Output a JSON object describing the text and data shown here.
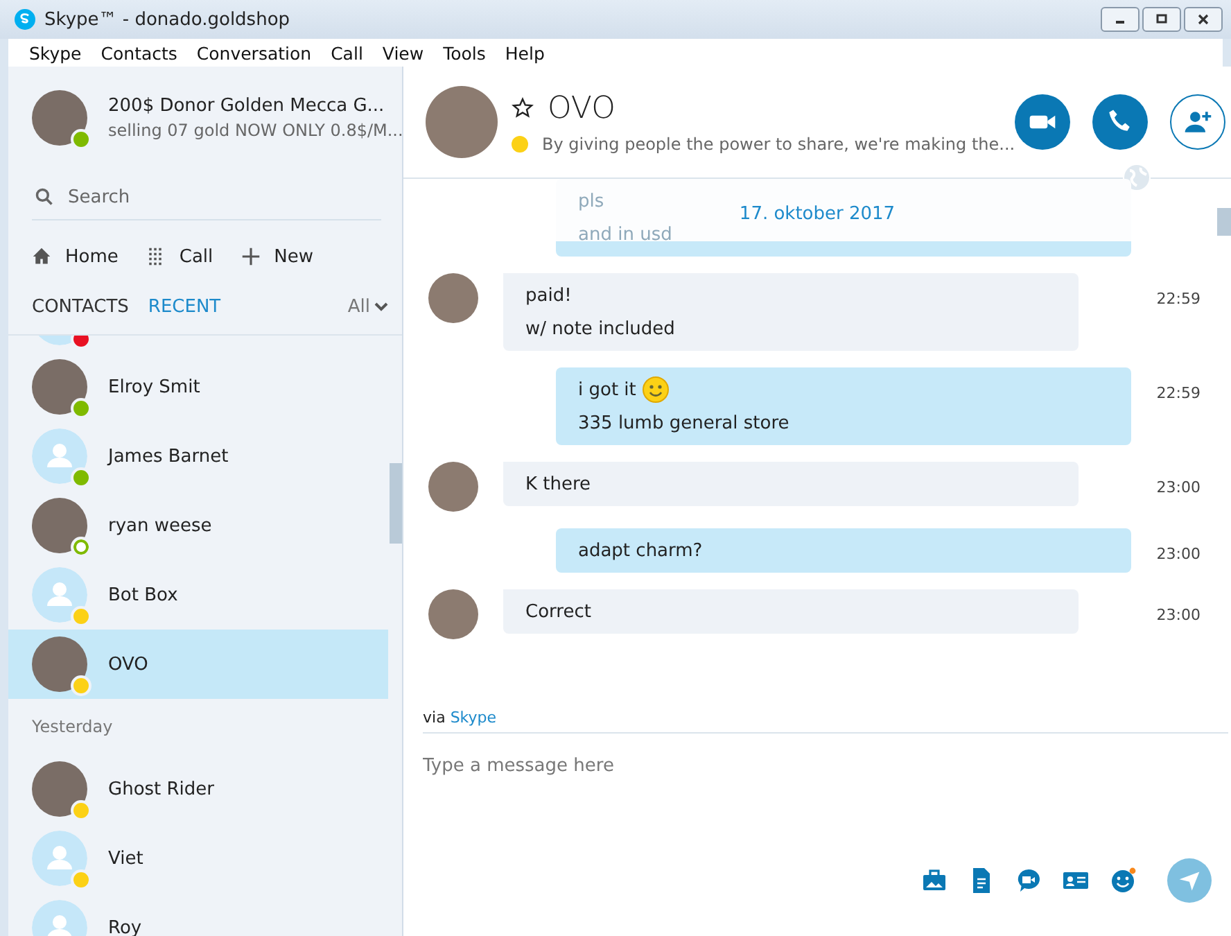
{
  "window": {
    "title": "Skype™ - donado.goldshop"
  },
  "menu": [
    "Skype",
    "Contacts",
    "Conversation",
    "Call",
    "View",
    "Tools",
    "Help"
  ],
  "profile": {
    "name": "200$ Donor Golden Mecca  G...",
    "mood": "selling 07 gold NOW ONLY 0.8$/M...",
    "color": "#7fba00"
  },
  "search": {
    "placeholder": "Search"
  },
  "nav": [
    {
      "label": "Home"
    },
    {
      "label": "Call"
    },
    {
      "label": "New"
    }
  ],
  "tabs": [
    {
      "label": "CONTACTS",
      "selected": false
    },
    {
      "label": "RECENT",
      "selected": true
    }
  ],
  "filter": "All",
  "contacts": [
    {
      "kind": "contact",
      "color": "#e81123",
      "hollow": false,
      "photo": false,
      "selected": false
    },
    {
      "kind": "contact",
      "name": "Elroy Smit",
      "color": "#7fba00",
      "hollow": false,
      "photo": true,
      "selected": false
    },
    {
      "kind": "contact",
      "name": "James Barnet",
      "color": "#7fba00",
      "hollow": false,
      "photo": false,
      "selected": false
    },
    {
      "kind": "contact",
      "name": "ryan weese",
      "color": "#7fba00",
      "hollow": true,
      "photo": true,
      "selected": false
    },
    {
      "kind": "contact",
      "name": "Bot Box",
      "color": "#fcd116",
      "hollow": false,
      "photo": false,
      "selected": false
    },
    {
      "kind": "contact",
      "name": "OVO",
      "color": "#fcd116",
      "hollow": false,
      "photo": true,
      "selected": true
    },
    {
      "kind": "heading",
      "name": "Yesterday"
    },
    {
      "kind": "contact",
      "name": "Ghost Rider",
      "color": "#fcd116",
      "hollow": false,
      "photo": true,
      "selected": false
    },
    {
      "kind": "contact",
      "name": "Viet",
      "color": "#fcd116",
      "hollow": false,
      "photo": false,
      "selected": false
    },
    {
      "kind": "contact",
      "name": "Roy",
      "photo": false,
      "selected": false
    }
  ],
  "chat": {
    "name": "OVO",
    "favorite": false,
    "color": "#fcd116",
    "mood": "By giving people the power to share, we're making the..."
  },
  "date_banner": "17. oktober 2017",
  "messages": [
    {
      "kind": "outgoing",
      "lines": [
        "pls",
        "and in usd"
      ],
      "faded": true
    },
    {
      "kind": "incoming",
      "lines": [
        "paid!",
        "w/ note included"
      ],
      "time": "22:59"
    },
    {
      "kind": "outgoing",
      "lines": [
        "i got it",
        "335 lumb general store"
      ],
      "emoji": true,
      "time": "22:59"
    },
    {
      "kind": "incoming",
      "lines": [
        "K there"
      ],
      "time": "23:00"
    },
    {
      "kind": "outgoing",
      "lines": [
        "adapt charm?"
      ],
      "time": "23:00"
    },
    {
      "kind": "incoming",
      "lines": [
        "Correct"
      ],
      "time": "23:00"
    }
  ],
  "via": {
    "prefix": "via",
    "link": "Skype"
  },
  "compose": {
    "placeholder": "Type a message here"
  }
}
